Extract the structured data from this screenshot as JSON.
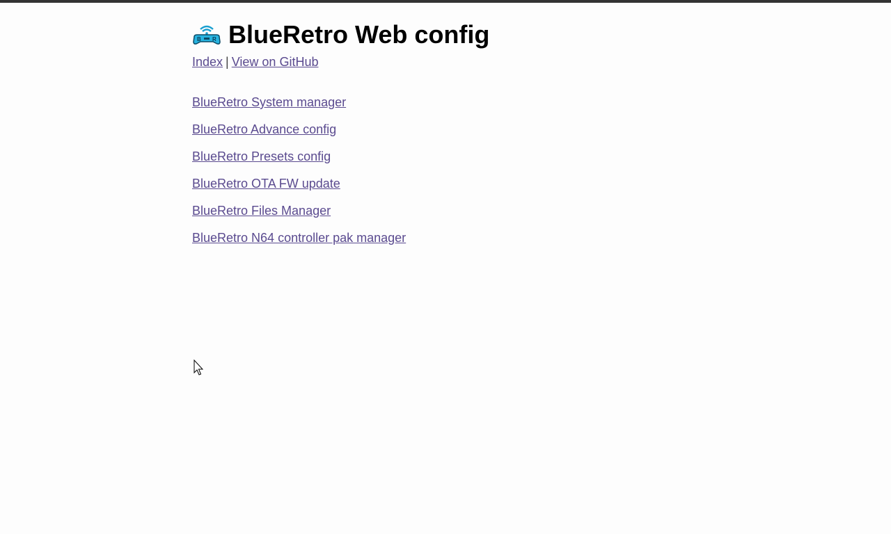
{
  "page": {
    "title": "BlueRetro Web config",
    "logo_icon": "blueretro-logo-icon",
    "background": "#fdfdfd",
    "link_color": "#5a4a8f"
  },
  "nav": {
    "index_label": "Index",
    "separator": "|",
    "github_label": "View on GitHub"
  },
  "links": [
    {
      "label": "BlueRetro System manager"
    },
    {
      "label": "BlueRetro Advance config"
    },
    {
      "label": "BlueRetro Presets config"
    },
    {
      "label": "BlueRetro OTA FW update"
    },
    {
      "label": "BlueRetro Files Manager"
    },
    {
      "label": "BlueRetro N64 controller pak manager"
    }
  ],
  "cursor": {
    "icon": "mouse-pointer-icon"
  }
}
